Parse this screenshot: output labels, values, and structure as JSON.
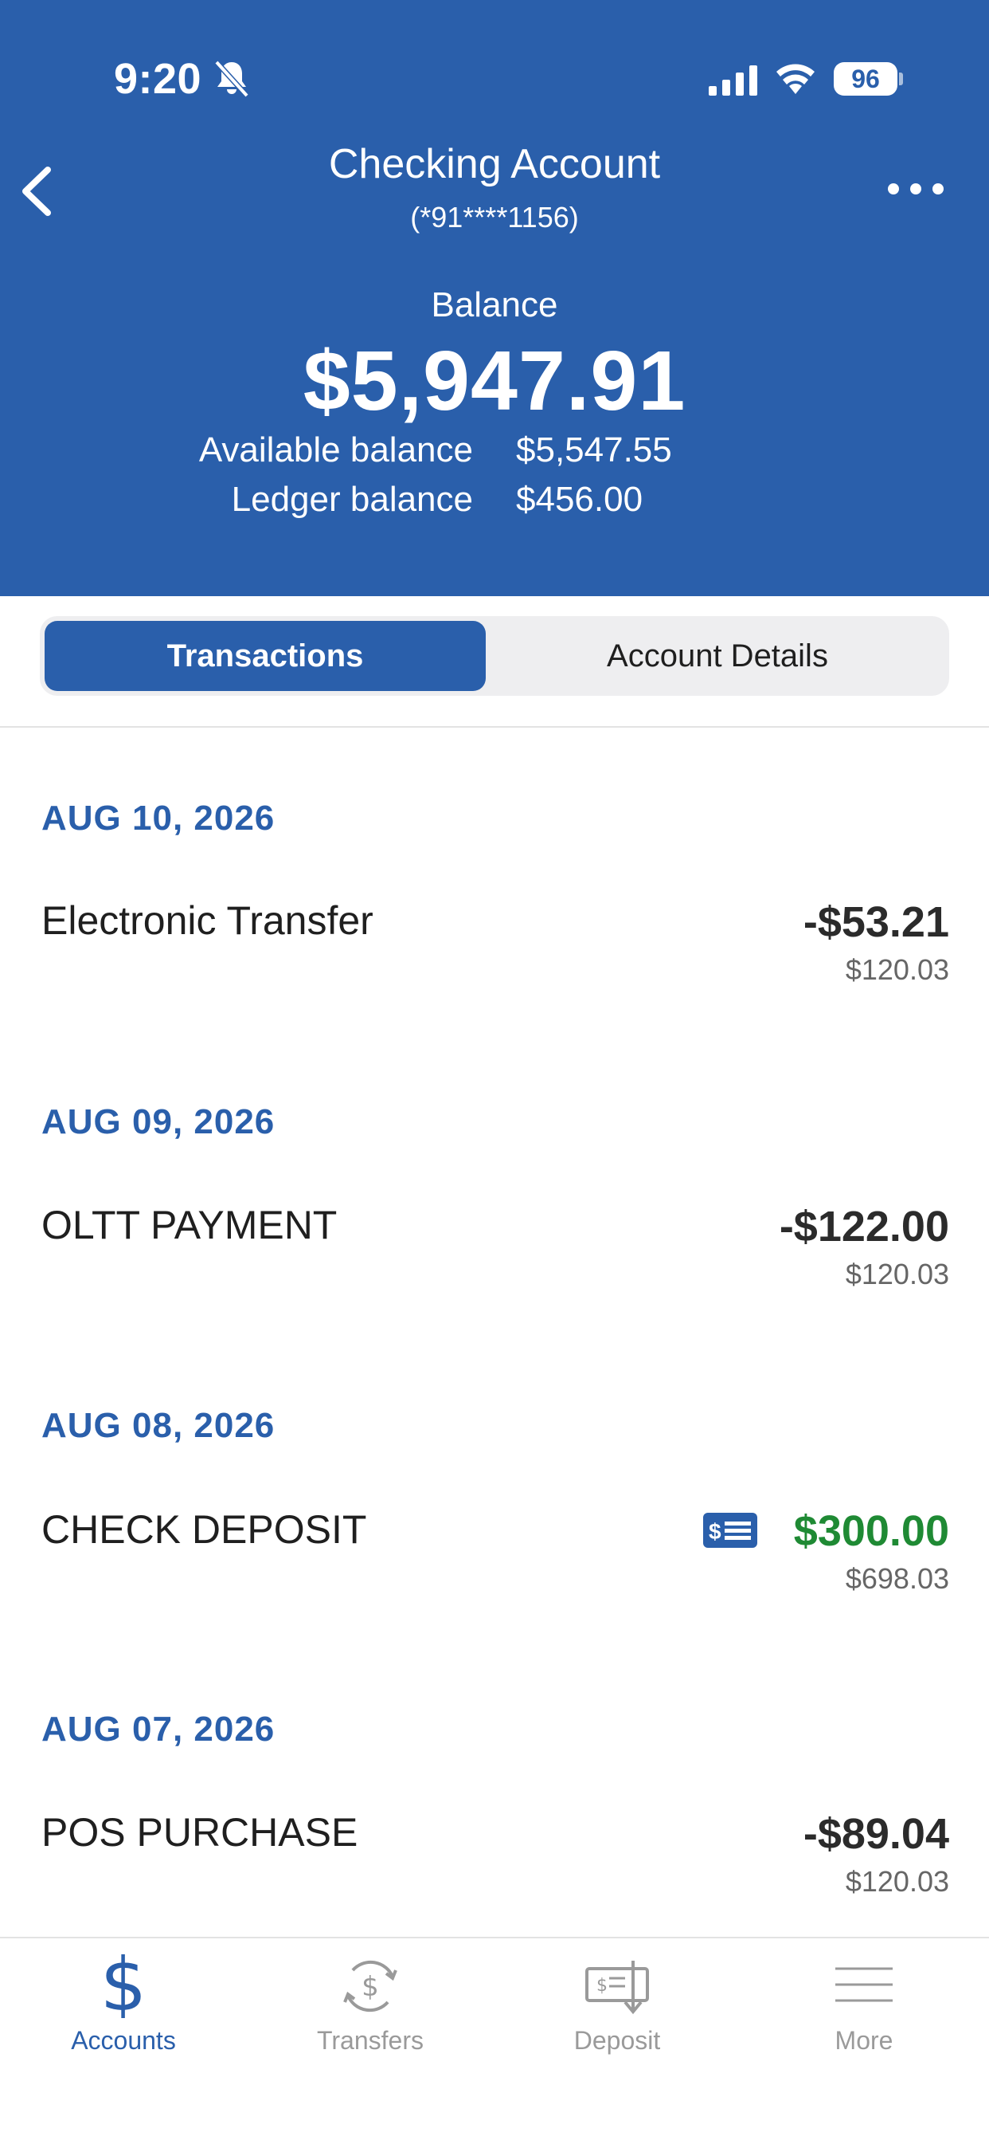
{
  "status_bar": {
    "time": "9:20",
    "battery": "96"
  },
  "header": {
    "title": "Checking Account",
    "account_number": "(*91****1156)",
    "balance_label": "Balance",
    "balance": "$5,947.91",
    "available_label": "Available balance",
    "available_value": "$5,547.55",
    "ledger_label": "Ledger balance",
    "ledger_value": "$456.00"
  },
  "segments": {
    "active": "Transactions",
    "inactive": "Account Details"
  },
  "transactions": [
    {
      "date": "AUG 10, 2026",
      "name": "Electronic Transfer",
      "amount": "-$53.21",
      "running_balance": "$120.03"
    },
    {
      "date": "AUG 09, 2026",
      "name": "OLTT PAYMENT",
      "amount": "-$122.00",
      "running_balance": "$120.03"
    },
    {
      "date": "AUG 08, 2026",
      "name": "CHECK DEPOSIT",
      "amount": "$300.00",
      "running_balance": "$698.03",
      "icon": "check-deposit-icon"
    },
    {
      "date": "AUG 07, 2026",
      "name": "POS PURCHASE",
      "amount": "-$89.04",
      "running_balance": "$120.03"
    }
  ],
  "tabbar": {
    "items": [
      {
        "label": "Accounts",
        "icon": "dollar-icon",
        "active": true
      },
      {
        "label": "Transfers",
        "icon": "transfer-icon",
        "active": false
      },
      {
        "label": "Deposit",
        "icon": "deposit-check-icon",
        "active": false
      },
      {
        "label": "More",
        "icon": "menu-icon",
        "active": false
      }
    ]
  },
  "colors": {
    "brand": "#2a5fab",
    "credit": "#1f8a34",
    "debit": "#2b2b2b"
  }
}
